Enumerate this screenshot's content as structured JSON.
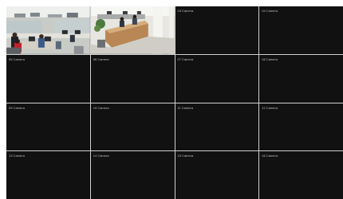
{
  "colors": {
    "tile_background": "#111111",
    "divider": "#cfcfcf",
    "label_text": "#bdbdbd"
  },
  "cameras": [
    {
      "label": "",
      "feed": "office-open-plan-desks"
    },
    {
      "label": "",
      "feed": "office-reception-counter"
    },
    {
      "label": "03 Camera"
    },
    {
      "label": "04 Camera"
    },
    {
      "label": "05 Camera"
    },
    {
      "label": "06 Camera"
    },
    {
      "label": "07 Camera"
    },
    {
      "label": "08 Camera"
    },
    {
      "label": "09 Camera"
    },
    {
      "label": "10 Camera"
    },
    {
      "label": "11 Camera"
    },
    {
      "label": "12 Camera"
    },
    {
      "label": "13 Camera"
    },
    {
      "label": "14 Camera"
    },
    {
      "label": "15 Camera"
    },
    {
      "label": "16 Camera"
    }
  ]
}
